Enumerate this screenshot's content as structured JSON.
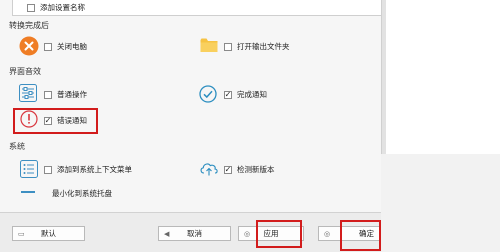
{
  "top_item": {
    "label": "添加设置名称"
  },
  "sections": {
    "after_convert": {
      "title": "转换完成后",
      "shutdown": {
        "label": "关闭电脑",
        "checked": false
      },
      "open_folder": {
        "label": "打开输出文件夹",
        "checked": false
      }
    },
    "sound": {
      "title": "界面音效",
      "normal_op": {
        "label": "普通操作",
        "checked": false
      },
      "complete_notice": {
        "label": "完成通知",
        "checked": true
      },
      "error_notice": {
        "label": "错误通知",
        "checked": true
      }
    },
    "system": {
      "title": "系统",
      "context_menu": {
        "label": "添加到系统上下文菜单",
        "checked": false
      },
      "check_update": {
        "label": "检测新版本",
        "checked": true
      },
      "minimize_tray": {
        "label": "最小化到系统托盘"
      }
    }
  },
  "buttons": {
    "default": "默认",
    "cancel": "取消",
    "apply": "应用",
    "ok": "确定"
  },
  "check_glyph": "✓",
  "colors": {
    "highlight": "#d21c1c",
    "orange": "#ef7d25",
    "folder": "#f6c343",
    "accent": "#2c8ec0"
  }
}
